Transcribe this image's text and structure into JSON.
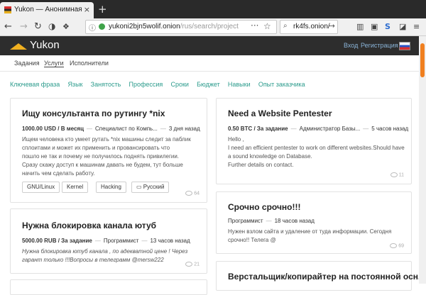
{
  "browser": {
    "tab_title": "Yukon — Анонимная фр",
    "tab_close": "×",
    "new_tab": "+",
    "url_host": "yukoni2bjn5wolif.onion",
    "url_path": "/rus/search/project",
    "url_dots": "···",
    "search_value": "rk4fs.onion/",
    "nav_back": "←",
    "nav_forward": "→",
    "nav_reload": "↻",
    "tool_s": "S"
  },
  "site": {
    "logo": "Yukon",
    "login": "Вход",
    "register": "Регистрация",
    "accent": "#f0b020",
    "link_color": "#2b9b8c"
  },
  "menu": [
    "Задания",
    "Услуги",
    "Исполнители"
  ],
  "filters": [
    "Ключевая фраза",
    "Язык",
    "Занятость",
    "Профессия",
    "Сроки",
    "Бюджет",
    "Навыки",
    "Опыт заказчика"
  ],
  "cards": [
    {
      "title": "Ищу консультанта по рутингу *nix",
      "price": "1000.00 USD / В месяц",
      "role": "Специалист по Компь...",
      "time": "3 дня назад",
      "desc": "Ищем человека кто умеет рутать *nix машины следит за паблик\nсплоитами и может их применить и провансировать что\nпошло не так и почему не получилось поднять привилегии.\nСразу скажу доступ к машинам давать не будем, тут больше\nначить чем сделать работу.",
      "tags": [
        "GNU/Linux",
        "Kernel",
        "Hacking",
        "Русский"
      ],
      "views": "64"
    },
    {
      "title": "Нужна блокировка канала ютуб",
      "price": "5000.00 RUB / За задание",
      "role": "Программист",
      "time": "13 часов назад",
      "desc": "Нужна блокировка ютуб канала , по адекватной цене ! Через\nгарант только !!!Вопросы в телеграмм @mersw222",
      "views": "21"
    },
    {
      "title": "Need a Website Pentester",
      "price": "0.50 BTC / За задание",
      "role": "Администратор Базы...",
      "time": "5 часов назад",
      "desc": "Hello ,\nI need an efficient pentester to work on different websites.Should have\na sound knowledge on Database.\nFurther details on contact.",
      "views": "11"
    },
    {
      "title": "Срочно срочно!!!",
      "price": "Программист",
      "time": "18 часов назад",
      "desc": "Нужен взлом сайта и удаление от туда информации. Сегодня\nсрочно!! Телега @",
      "views": "69"
    },
    {
      "title": "Верстальщик/копирайтер на постоянной осн..."
    }
  ]
}
